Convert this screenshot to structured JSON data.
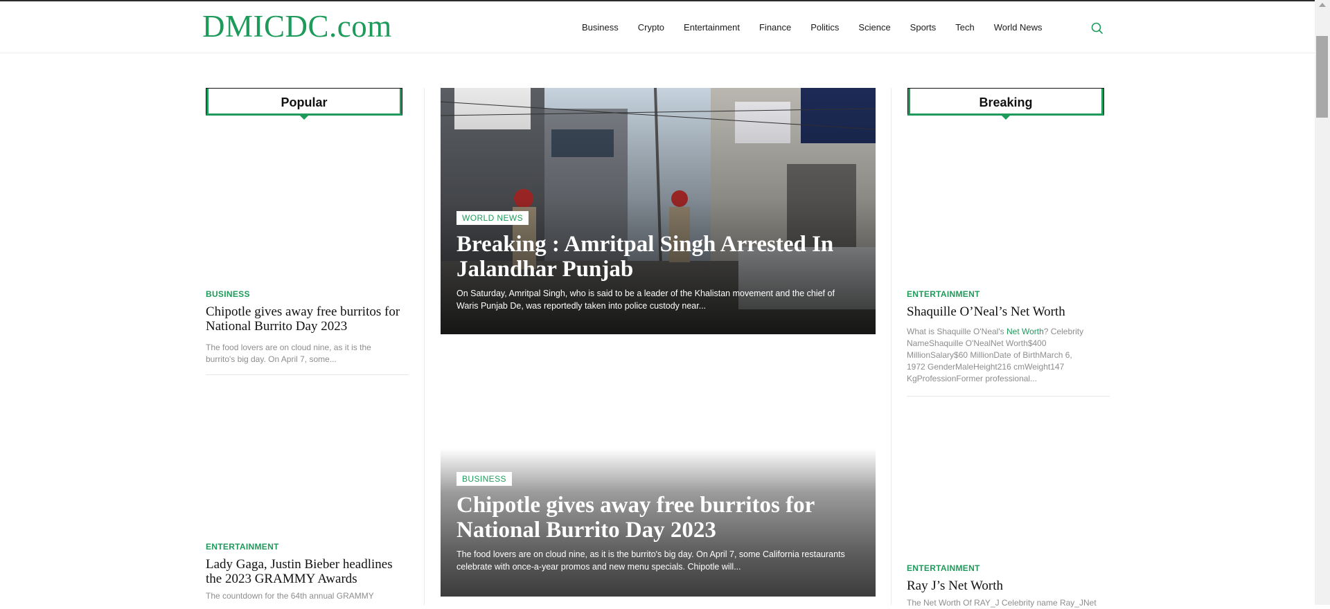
{
  "site": {
    "logo": "DMICDC.com"
  },
  "nav": {
    "items": [
      "Business",
      "Crypto",
      "Entertainment",
      "Finance",
      "Politics",
      "Science",
      "Sports",
      "Tech",
      "World News"
    ],
    "search_icon": "search-icon"
  },
  "popular": {
    "heading": "Popular",
    "posts": [
      {
        "category": "BUSINESS",
        "title": "Chipotle gives away free burritos for National Burrito Day 2023",
        "excerpt": "The food lovers are on cloud nine, as it is the burrito's big day. On April 7, some..."
      },
      {
        "category": "ENTERTAINMENT",
        "title": "Lady Gaga, Justin Bieber headlines the 2023 GRAMMY Awards",
        "excerpt": "The countdown for the 64th annual GRAMMY"
      }
    ]
  },
  "featured": [
    {
      "category": "WORLD NEWS",
      "title": "Breaking : Amritpal Singh Arrested In Jalandhar Punjab",
      "excerpt": "On Saturday, Amritpal Singh, who is said to be a leader of the Khalistan movement and the chief of Waris Punjab De, was reportedly taken into police custody near..."
    },
    {
      "category": "BUSINESS",
      "title": "Chipotle gives away free burritos for National Burrito Day 2023",
      "excerpt": "The food lovers are on cloud nine, as it is the burrito's big day. On April 7, some California restaurants celebrate with once-a-year promos and new menu specials.   Chipotle will..."
    }
  ],
  "breaking": {
    "heading": "Breaking",
    "posts": [
      {
        "category": "ENTERTAINMENT",
        "title": "Shaquille O’Neal’s Net Worth",
        "excerpt_before": "What is Shaquille O'Neal's ",
        "excerpt_link": "Net Worth",
        "excerpt_after": "? Celebrity NameShaquille O'NealNet Worth$400 MillionSalary$60 MillionDate of BirthMarch 6, 1972 GenderMaleHeight216 cmWeight147 KgProfessionFormer professional..."
      },
      {
        "category": "ENTERTAINMENT",
        "title": "Ray J’s Net Worth",
        "excerpt": "The Net Worth Of RAY_J Celebrity name Ray_JNet"
      }
    ]
  },
  "colors": {
    "accent": "#1e9b5b",
    "text": "#111111",
    "muted": "#8d8d8d"
  }
}
